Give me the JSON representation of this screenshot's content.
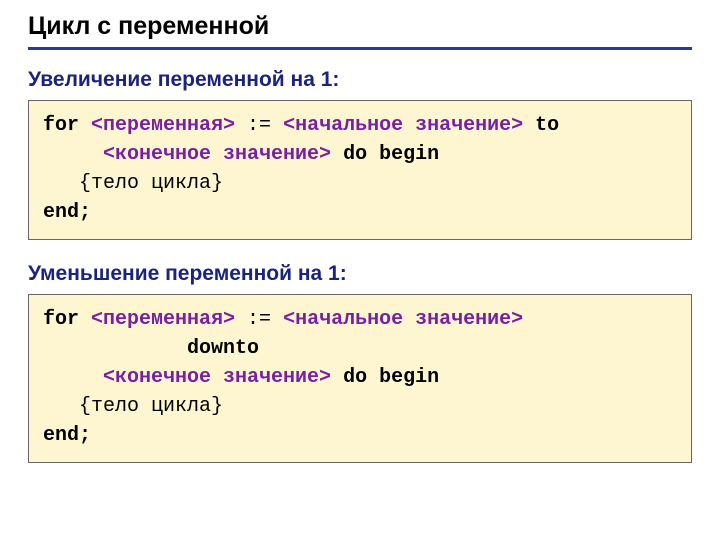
{
  "title": "Цикл с переменной",
  "section1": {
    "heading": "Увеличение переменной на 1:",
    "code": {
      "l1_kw": "for ",
      "l1_ph1": "<переменная>",
      "l1_mid": " := ",
      "l1_ph2": "<начальное значение>",
      "l1_kw2": " to",
      "l2_indent": "     ",
      "l2_ph": "<конечное значение>",
      "l2_mid": " ",
      "l2_kw": "do begin",
      "l3_indent": "   ",
      "l3_txt": "{тело цикла}",
      "l4_kw": "end;"
    }
  },
  "section2": {
    "heading": "Уменьшение переменной на 1:",
    "code": {
      "l1_kw": "for ",
      "l1_ph1": "<переменная>",
      "l1_mid": " := ",
      "l1_ph2": "<начальное значение>",
      "l2_indent": "            ",
      "l2_kw": "downto",
      "l3_indent": "     ",
      "l3_ph": "<конечное значение>",
      "l3_mid": " ",
      "l3_kw": "do begin",
      "l4_indent": "   ",
      "l4_txt": "{тело цикла}",
      "l5_kw": "end;"
    }
  }
}
